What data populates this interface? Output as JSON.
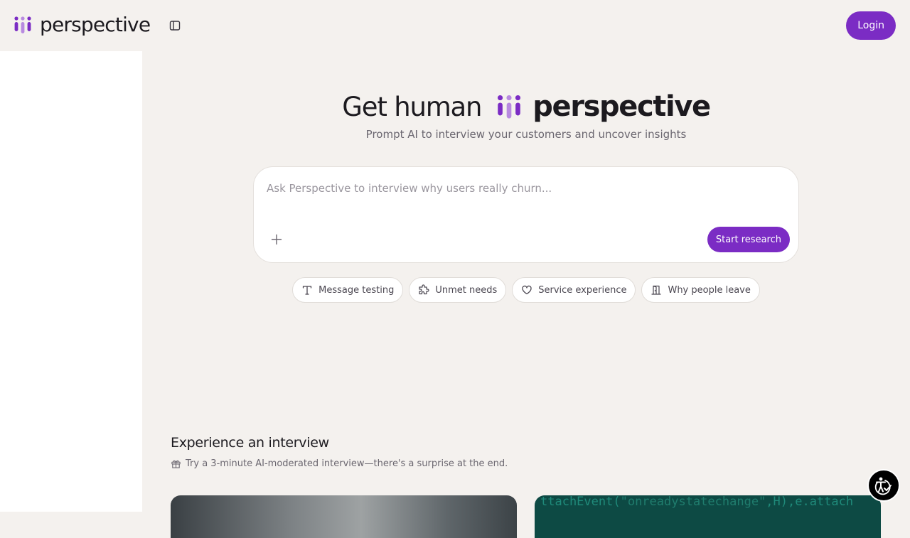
{
  "header": {
    "brand": "perspective",
    "login_label": "Login"
  },
  "hero": {
    "title_prefix": "Get human",
    "brand": "perspective",
    "subtitle": "Prompt AI to interview your customers and uncover insights"
  },
  "prompt": {
    "placeholder": "Ask Perspective to interview why users really churn...",
    "value": "",
    "start_label": "Start research"
  },
  "chips": [
    {
      "label": "Message testing",
      "icon": "text-icon"
    },
    {
      "label": "Unmet needs",
      "icon": "puzzle-icon"
    },
    {
      "label": "Service experience",
      "icon": "heart-icon"
    },
    {
      "label": "Why people leave",
      "icon": "door-icon"
    }
  ],
  "experience": {
    "title": "Experience an interview",
    "subtitle": "Try a 3-minute AI-moderated interview—there's a surprise at the end."
  },
  "cards": {
    "code_prefix": "ttachEvent(",
    "code_string": "\"onreadystatechange\"",
    "code_suffix": ",H),e.attach"
  },
  "colors": {
    "accent": "#7b2cc4",
    "background": "#f4f1ee",
    "sidebar": "#ffffff",
    "logo_light": "#b88ae0",
    "logo_dark": "#7b2cc4"
  }
}
